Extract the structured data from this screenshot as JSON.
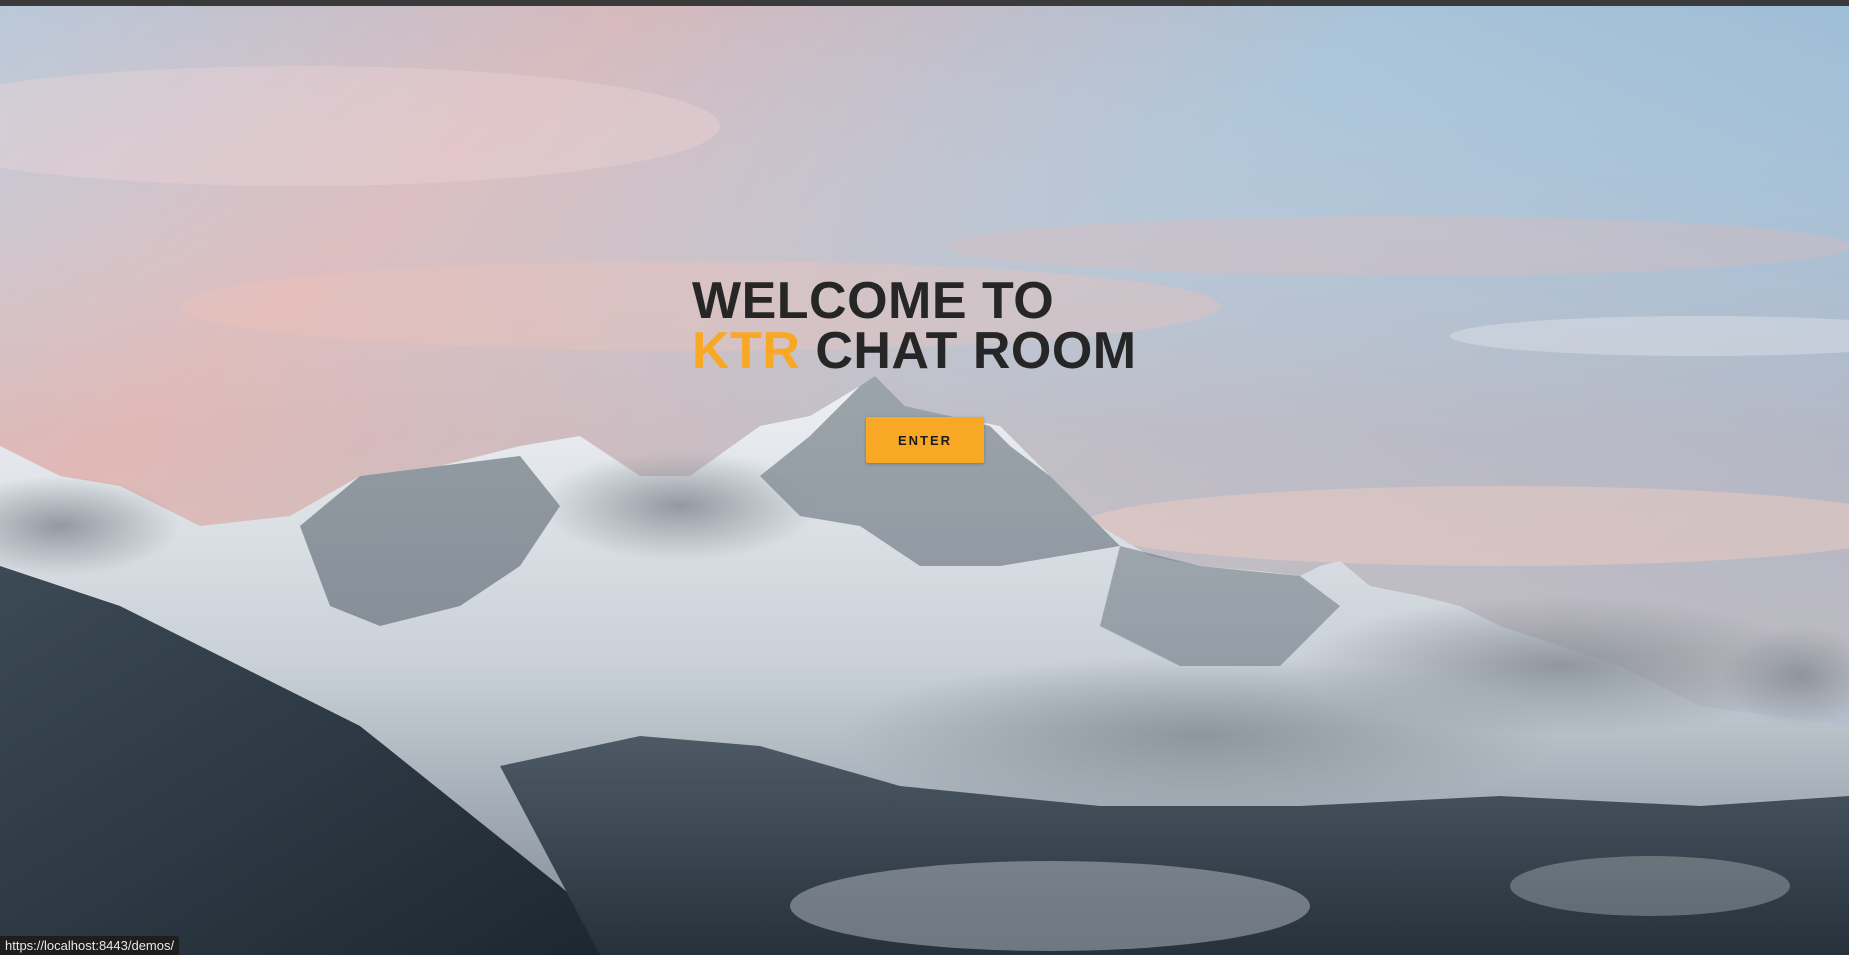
{
  "hero": {
    "headline_line1": "WELCOME TO",
    "headline_accent": "KTR",
    "headline_rest": " CHAT ROOM",
    "enter_label": "ENTER",
    "accent_color": "#f9a826",
    "text_color": "#262626",
    "background_image": "snowy-mountain-at-dusk"
  },
  "status_bar": {
    "url": "https://localhost:8443/demos/"
  }
}
